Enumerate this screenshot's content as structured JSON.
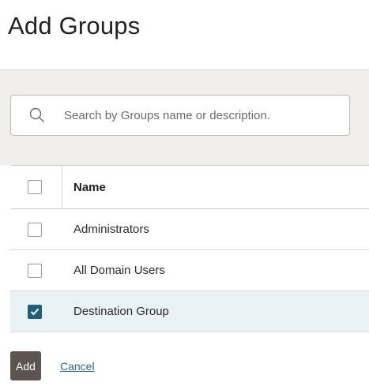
{
  "dialog": {
    "title": "Add Groups"
  },
  "search": {
    "icon": "search-icon",
    "placeholder": "Search by Groups name or description.",
    "value": ""
  },
  "table": {
    "header": {
      "name_label": "Name",
      "select_all_checked": false
    },
    "rows": [
      {
        "name": "Administrators",
        "checked": false
      },
      {
        "name": "All Domain Users",
        "checked": false
      },
      {
        "name": "Destination Group",
        "checked": true
      }
    ]
  },
  "footer": {
    "add_label": "Add",
    "cancel_label": "Cancel"
  },
  "colors": {
    "primary_button": "#5b5450",
    "checkbox_checked": "#1f5f7a",
    "selected_row": "#e9f2f5",
    "link": "#2a6a8a",
    "band": "#f1efed"
  }
}
